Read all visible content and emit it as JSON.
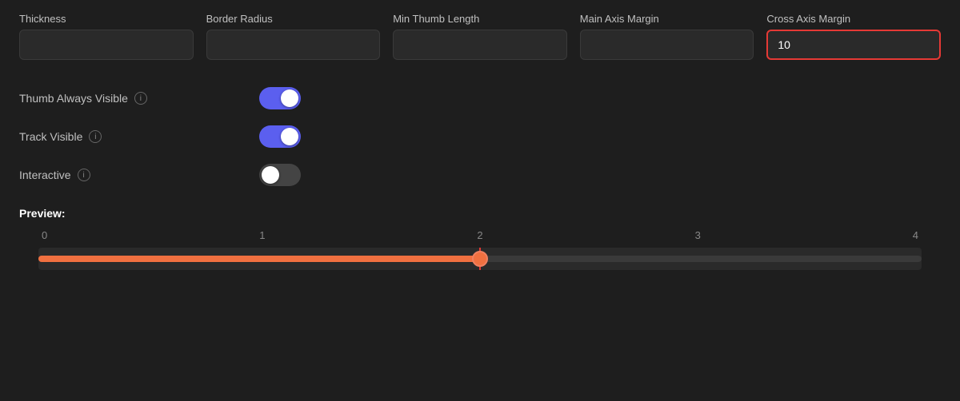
{
  "fields": {
    "thickness": {
      "label": "Thickness",
      "value": "",
      "placeholder": ""
    },
    "borderRadius": {
      "label": "Border Radius",
      "value": "",
      "placeholder": ""
    },
    "minThumbLength": {
      "label": "Min Thumb Length",
      "value": "",
      "placeholder": ""
    },
    "mainAxisMargin": {
      "label": "Main Axis Margin",
      "value": "",
      "placeholder": ""
    },
    "crossAxisMargin": {
      "label": "Cross Axis Margin",
      "value": "10",
      "placeholder": ""
    }
  },
  "toggles": {
    "thumbAlwaysVisible": {
      "label": "Thumb Always Visible",
      "state": "on"
    },
    "trackVisible": {
      "label": "Track Visible",
      "state": "on"
    },
    "interactive": {
      "label": "Interactive",
      "state": "off"
    }
  },
  "preview": {
    "label": "Preview:",
    "tickLabels": [
      "0",
      "1",
      "2",
      "3",
      "4"
    ],
    "sliderValue": 2,
    "sliderMin": 0,
    "sliderMax": 4,
    "fillPercent": 50,
    "markerPercent": 50
  },
  "icons": {
    "infoIcon": "i"
  }
}
